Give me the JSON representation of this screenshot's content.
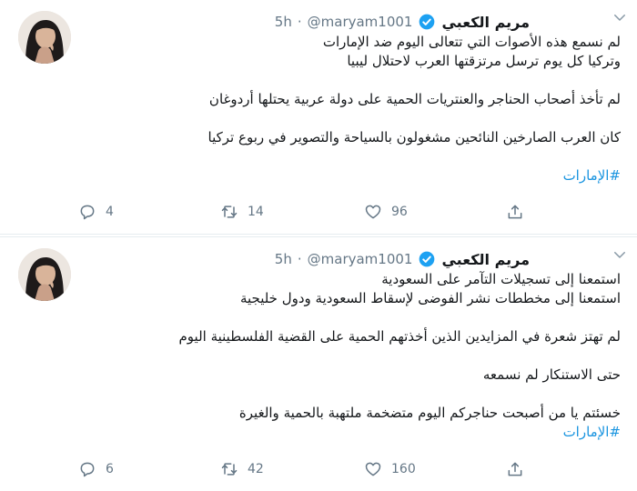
{
  "tweets": [
    {
      "display_name": "مريم الكعبي",
      "handle": "@maryam1001",
      "separator": "·",
      "time": "5h",
      "paragraphs": [
        [
          "لم نسمع هذه الأصوات التي تتعالى اليوم ضد الإمارات",
          "وتركيا كل يوم ترسل مرتزقتها العرب لاحتلال ليبيا"
        ],
        [
          "لم تأخذ أصحاب الحناجر والعنتريات الحمية على دولة عربية يحتلها أردوغان"
        ],
        [
          "كان العرب الصارخين النائحين مشغولون بالسياحة والتصوير في ربوع تركيا"
        ]
      ],
      "hashtag": "#الإمارات",
      "replies": "4",
      "retweets": "14",
      "likes": "96"
    },
    {
      "display_name": "مريم الكعبي",
      "handle": "@maryam1001",
      "separator": "·",
      "time": "5h",
      "paragraphs": [
        [
          "استمعنا إلى تسجيلات التآمر على السعودية",
          "استمعنا إلى مخططات نشر الفوضى لإسقاط السعودية ودول خليجية"
        ],
        [
          "لم تهتز شعرة في المزايدين الذين أخذتهم الحمية على القضية الفلسطينية اليوم"
        ],
        [
          "حتى الاستنكار لم نسمعه"
        ],
        [
          "خسئتم يا من أصبحت حناجركم اليوم متضخمة ملتهبة بالحمية والغيرة"
        ]
      ],
      "hashtag": "#الإمارات",
      "replies": "6",
      "retweets": "42",
      "likes": "160"
    }
  ],
  "colors": {
    "accent": "#1b95e0",
    "muted": "#657786",
    "text": "#14171a",
    "verified": "#1da1f2"
  },
  "icons": [
    "chevron-down-icon",
    "verified-badge-icon",
    "reply-icon",
    "retweet-icon",
    "like-icon",
    "share-icon"
  ]
}
